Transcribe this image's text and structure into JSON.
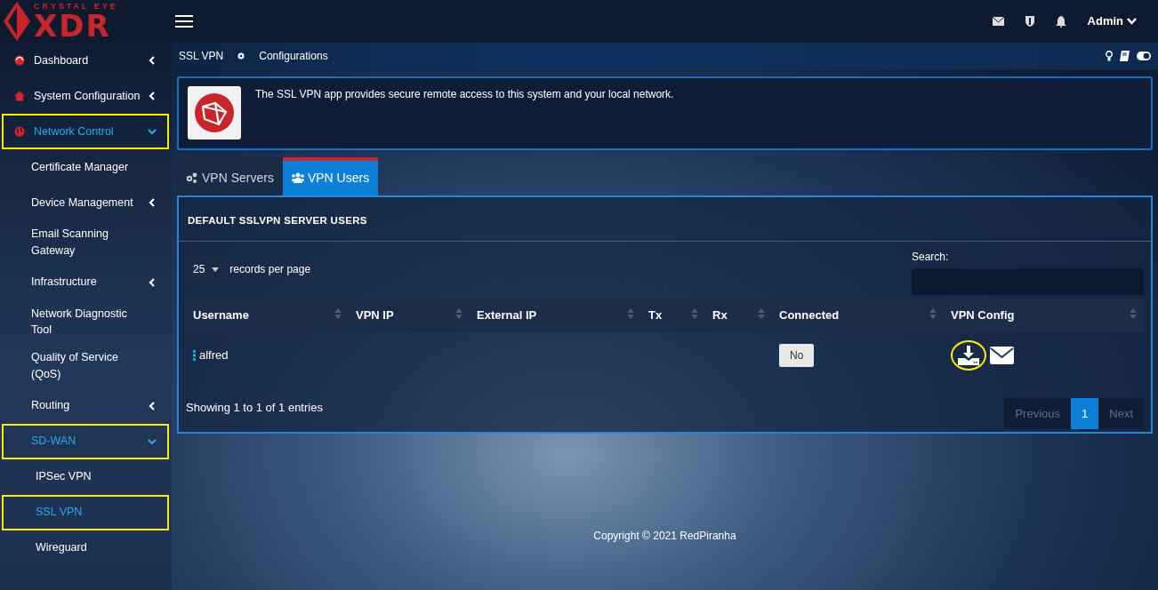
{
  "logo": {
    "top": "CRYSTAL EYE",
    "main": "XDR"
  },
  "topbar": {
    "user": "Admin"
  },
  "sidebar": {
    "items": [
      {
        "label": "Dashboard",
        "expanded": false,
        "selected": false,
        "highlighted": false
      },
      {
        "label": "System Configuration",
        "expanded": false,
        "selected": false,
        "highlighted": false
      },
      {
        "label": "Network Control",
        "expanded": true,
        "selected": true,
        "highlighted": true,
        "children": [
          {
            "label": "Certificate Manager",
            "selected": false,
            "highlighted": false
          },
          {
            "label": "Device Management",
            "expanded": false,
            "selected": false,
            "highlighted": false
          },
          {
            "label": "Email Scanning Gateway",
            "selected": false,
            "highlighted": false
          },
          {
            "label": "Infrastructure",
            "expanded": false,
            "selected": false,
            "highlighted": false
          },
          {
            "label": "Network Diagnostic Tool",
            "selected": false,
            "highlighted": false
          },
          {
            "label": "Quality of Service (QoS)",
            "selected": false,
            "highlighted": false
          },
          {
            "label": "Routing",
            "expanded": false,
            "selected": false,
            "highlighted": false
          },
          {
            "label": "SD-WAN",
            "expanded": true,
            "selected": true,
            "highlighted": true,
            "children": [
              {
                "label": "IPSec VPN",
                "selected": false,
                "highlighted": false
              },
              {
                "label": "SSL VPN",
                "selected": true,
                "highlighted": true
              },
              {
                "label": "Wireguard",
                "selected": false,
                "highlighted": false
              }
            ]
          }
        ]
      }
    ]
  },
  "breadcrumb": [
    "SSL VPN",
    "Configurations"
  ],
  "info": {
    "text": "The SSL VPN app provides secure remote access to this system and your local network."
  },
  "tabs": [
    {
      "label": "VPN Servers",
      "selected": false
    },
    {
      "label": "VPN Users",
      "selected": true
    }
  ],
  "panel": {
    "title": "DEFAULT SSLVPN SERVER USERS",
    "page_size": "25",
    "page_size_label": "records per page",
    "search_label": "Search:"
  },
  "table": {
    "columns": [
      "Username",
      "VPN IP",
      "External IP",
      "Tx",
      "Rx",
      "Connected",
      "VPN Config"
    ],
    "rows": [
      {
        "username": "alfred",
        "connected": "No",
        "download_highlighted": true
      }
    ]
  },
  "summary": "Showing 1 to 1 of 1 entries",
  "pagination": [
    {
      "label": "Previous",
      "selected": false,
      "disabled": true
    },
    {
      "label": "1",
      "selected": true,
      "disabled": false
    },
    {
      "label": "Next",
      "selected": false,
      "disabled": true
    }
  ],
  "footer": "Copyright © 2021 RedPiranha"
}
